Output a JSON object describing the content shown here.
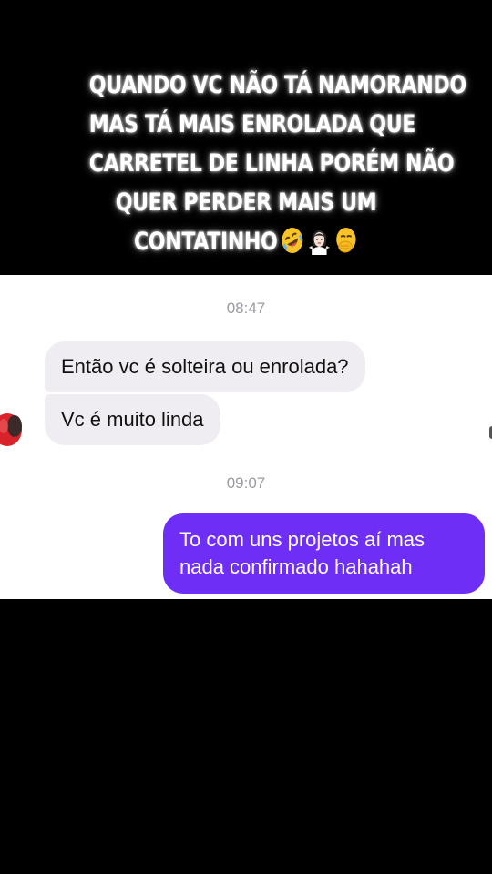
{
  "caption": {
    "lines": [
      "QUANDO VC NÃO TÁ NAMORANDO",
      "MAS TÁ MAIS ENROLADA QUE",
      "CARRETEL DE LINHA PORÉM NÃO",
      "QUER PERDER MAIS UM",
      "CONTATINHO"
    ],
    "emojis": [
      "rolling-on-floor-laughing-emoji",
      "person-shrugging-emoji",
      "face-with-hand-over-mouth-emoji"
    ]
  },
  "chat": {
    "timestamps": [
      "08:47",
      "09:07"
    ],
    "messages": [
      {
        "direction": "incoming",
        "text": "Então vc é solteira ou enrolada?"
      },
      {
        "direction": "incoming",
        "text": "Vc é muito linda"
      },
      {
        "direction": "outgoing",
        "text": "To com uns projetos aí mas nada confirmado hahahah"
      }
    ]
  },
  "colors": {
    "background": "#000000",
    "chat_background": "#ffffff",
    "incoming_bubble": "#efedf1",
    "outgoing_bubble": "#6f2ef5",
    "timestamp": "#9a9aa2"
  }
}
